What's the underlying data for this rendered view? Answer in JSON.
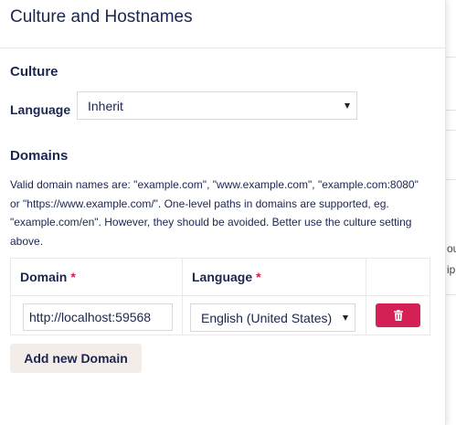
{
  "dialog": {
    "title": "Culture and Hostnames"
  },
  "culture": {
    "section_title": "Culture",
    "language_label": "Language",
    "language_value": "Inherit"
  },
  "domains": {
    "section_title": "Domains",
    "help_text": "Valid domain names are: \"example.com\", \"www.example.com\", \"example.com:8080\" or \"https://www.example.com/\". One-level paths in domains are supported, eg. \"example.com/en\". However, they should be avoided. Better use the culture setting above.",
    "table": {
      "columns": [
        "Domain",
        "Language",
        ""
      ],
      "required_marker": "*",
      "rows": [
        {
          "domain": "http://localhost:59568",
          "language": "English (United States)"
        }
      ]
    },
    "add_button": "Add new Domain"
  },
  "colors": {
    "text": "#1b264f",
    "danger": "#d42054",
    "add_button_bg": "#f3ece8",
    "border": "#d8d7d9"
  },
  "icons": {
    "delete": "trash-icon",
    "dropdown": "caret-down-icon"
  }
}
